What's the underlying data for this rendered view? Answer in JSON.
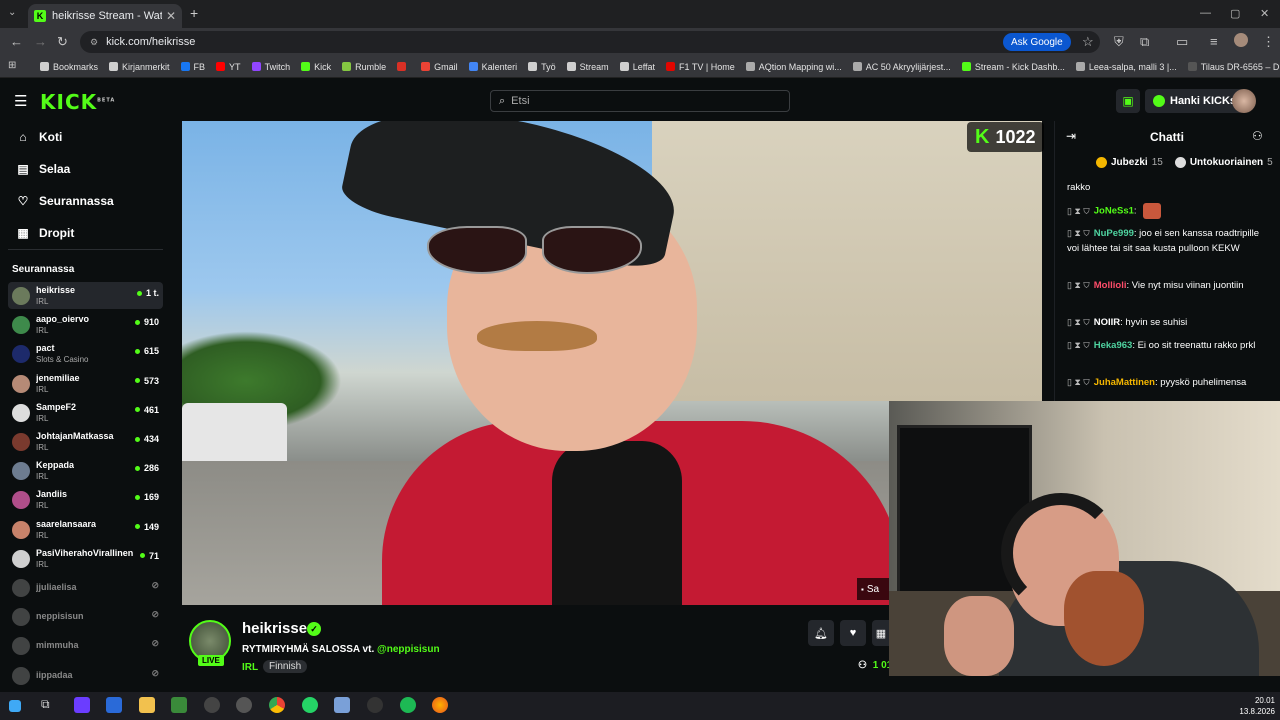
{
  "browser": {
    "tab_title": "heikrisse Stream - Watch Live",
    "url": "kick.com/heikrisse",
    "ask_google": "Ask Google",
    "bookmarks": [
      {
        "label": "Bookmarks",
        "color": "#cfcfcf"
      },
      {
        "label": "Kirjanmerkit",
        "color": "#cfcfcf"
      },
      {
        "label": "FB",
        "color": "#1877f2"
      },
      {
        "label": "YT",
        "color": "#ff0000"
      },
      {
        "label": "Twitch",
        "color": "#9146ff"
      },
      {
        "label": "Kick",
        "color": "#53fc18"
      },
      {
        "label": "Rumble",
        "color": "#85c742"
      },
      {
        "label": "",
        "color": "#d93025"
      },
      {
        "label": "Gmail",
        "color": "#ea4335"
      },
      {
        "label": "Kalenteri",
        "color": "#4285f4"
      },
      {
        "label": "Työ",
        "color": "#cfcfcf"
      },
      {
        "label": "Stream",
        "color": "#cfcfcf"
      },
      {
        "label": "Leffat",
        "color": "#cfcfcf"
      },
      {
        "label": "F1 TV | Home",
        "color": "#e10600"
      },
      {
        "label": "AQtion Mapping wi...",
        "color": "#aaaaaa"
      },
      {
        "label": "AC 50 Akryylijärjest...",
        "color": "#aaaaaa"
      },
      {
        "label": "Stream - Kick Dashb...",
        "color": "#53fc18"
      },
      {
        "label": "Leea-salpa, malli 3 |...",
        "color": "#aaaaaa"
      },
      {
        "label": "Tilaus DR-6565 – D...",
        "color": "#555555"
      }
    ]
  },
  "kick": {
    "logo": "KICK",
    "logo_beta": "BETA",
    "search_placeholder": "Etsi",
    "hanki": "Hanki KICKs"
  },
  "sidebar": {
    "nav": [
      {
        "label": "Koti",
        "icon": "home-icon",
        "glyph": "⌂"
      },
      {
        "label": "Selaa",
        "icon": "browse-icon",
        "glyph": "▤"
      },
      {
        "label": "Seurannassa",
        "icon": "heart-icon",
        "glyph": "♡"
      },
      {
        "label": "Dropit",
        "icon": "drops-icon",
        "glyph": "▦"
      }
    ],
    "following_header": "Seurannassa",
    "channels": [
      {
        "name": "heikrisse",
        "category": "IRL",
        "viewers": "1 t.",
        "live": true,
        "active": true,
        "color": "#6b7a5c"
      },
      {
        "name": "aapo_oiervo",
        "category": "IRL",
        "viewers": "910",
        "live": true,
        "color": "#3e8a4b"
      },
      {
        "name": "pact",
        "category": "Slots & Casino",
        "viewers": "615",
        "live": true,
        "color": "#1d2a6b"
      },
      {
        "name": "jenemiliae",
        "category": "IRL",
        "viewers": "573",
        "live": true,
        "color": "#b68a76"
      },
      {
        "name": "SampeF2",
        "category": "IRL",
        "viewers": "461",
        "live": true,
        "color": "#dddddd"
      },
      {
        "name": "JohtajanMatkassa",
        "category": "IRL",
        "viewers": "434",
        "live": true,
        "color": "#7a3a2e"
      },
      {
        "name": "Keppada",
        "category": "IRL",
        "viewers": "286",
        "live": true,
        "color": "#6d7c90"
      },
      {
        "name": "Jandiis",
        "category": "IRL",
        "viewers": "169",
        "live": true,
        "color": "#b04e8a"
      },
      {
        "name": "saarelansaara",
        "category": "IRL",
        "viewers": "149",
        "live": true,
        "color": "#c7826a"
      },
      {
        "name": "PasiViherahoVirallinen",
        "category": "IRL",
        "viewers": "71",
        "live": true,
        "color": "#cfcfcf"
      },
      {
        "name": "jjuliaelisa",
        "category": "",
        "viewers": "",
        "live": false,
        "color": "#777777"
      },
      {
        "name": "neppisisun",
        "category": "",
        "viewers": "",
        "live": false,
        "color": "#777777"
      },
      {
        "name": "mimmuha",
        "category": "",
        "viewers": "",
        "live": false,
        "color": "#777777"
      },
      {
        "name": "iippadaa",
        "category": "",
        "viewers": "",
        "live": false,
        "color": "#777777"
      }
    ]
  },
  "video": {
    "viewer_overlay": "1022",
    "subtitle_overlay": "Sa"
  },
  "stream": {
    "name": "heikrisse",
    "live": "LIVE",
    "title": "RYTMIRYHMÄ SALOSSA vt. ",
    "mention": "@neppisisun",
    "category": "IRL",
    "tag": "Finnish",
    "viewers_partial": "1 01"
  },
  "chat": {
    "title": "Chatti",
    "top_gifters": [
      {
        "name": "Jubezki",
        "count": "15"
      },
      {
        "name": "Untokuoriainen",
        "count": "5"
      }
    ],
    "messages": [
      {
        "user": "",
        "color": "#ffffff",
        "text": "rakko"
      },
      {
        "user": "JoNeSs1",
        "color": "#53fc18",
        "text": ""
      },
      {
        "user": "NuPe999",
        "color": "#4fd3a0",
        "text": "joo ei sen kanssa roadtripille voi lähtee tai sit saa kusta pulloon KEKW"
      },
      {
        "user": "Mollioli",
        "color": "#ff4d6a",
        "text": "Vie nyt misu viinan juontiin"
      },
      {
        "user": "NOIIR",
        "color": "#ffffff",
        "text": "hyvin se suhisi"
      },
      {
        "user": "Heka963",
        "color": "#4fd3a0",
        "text": "Ei oo sit treenattu rakko prkl"
      },
      {
        "user": "JuhaMattinen",
        "color": "#f5b700",
        "text": "pyyskö puhelimensa"
      }
    ]
  },
  "taskbar": {
    "time": "20.01",
    "date": "13.8.2026"
  }
}
